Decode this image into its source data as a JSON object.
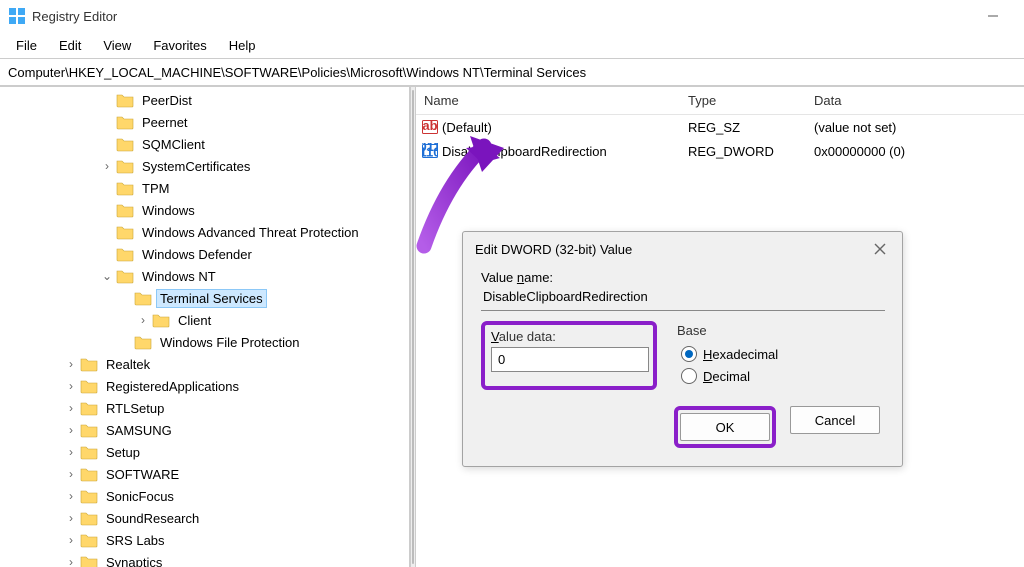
{
  "window": {
    "title": "Registry Editor"
  },
  "menu": {
    "file": "File",
    "edit": "Edit",
    "view": "View",
    "favorites": "Favorites",
    "help": "Help"
  },
  "address": "Computer\\HKEY_LOCAL_MACHINE\\SOFTWARE\\Policies\\Microsoft\\Windows NT\\Terminal Services",
  "columns": {
    "name": "Name",
    "type": "Type",
    "data": "Data"
  },
  "values": [
    {
      "name": "(Default)",
      "type": "REG_SZ",
      "data": "(value not set)",
      "icon": "string"
    },
    {
      "name": "DisableClipboardRedirection",
      "type": "REG_DWORD",
      "data": "0x00000000 (0)",
      "icon": "binary"
    }
  ],
  "tree": [
    {
      "d": 5,
      "t": "",
      "n": "PeerDist"
    },
    {
      "d": 5,
      "t": "",
      "n": "Peernet"
    },
    {
      "d": 5,
      "t": "",
      "n": "SQMClient"
    },
    {
      "d": 5,
      "t": ">",
      "n": "SystemCertificates"
    },
    {
      "d": 5,
      "t": "",
      "n": "TPM"
    },
    {
      "d": 5,
      "t": "",
      "n": "Windows"
    },
    {
      "d": 5,
      "t": "",
      "n": "Windows Advanced Threat Protection"
    },
    {
      "d": 5,
      "t": "",
      "n": "Windows Defender"
    },
    {
      "d": 5,
      "t": "v",
      "n": "Windows NT"
    },
    {
      "d": 6,
      "t": "",
      "n": "Terminal Services",
      "sel": true
    },
    {
      "d": 7,
      "t": ">",
      "n": "Client"
    },
    {
      "d": 6,
      "t": "",
      "n": "Windows File Protection"
    },
    {
      "d": 3,
      "t": ">",
      "n": "Realtek"
    },
    {
      "d": 3,
      "t": ">",
      "n": "RegisteredApplications"
    },
    {
      "d": 3,
      "t": ">",
      "n": "RTLSetup"
    },
    {
      "d": 3,
      "t": ">",
      "n": "SAMSUNG"
    },
    {
      "d": 3,
      "t": ">",
      "n": "Setup"
    },
    {
      "d": 3,
      "t": ">",
      "n": "SOFTWARE"
    },
    {
      "d": 3,
      "t": ">",
      "n": "SonicFocus"
    },
    {
      "d": 3,
      "t": ">",
      "n": "SoundResearch"
    },
    {
      "d": 3,
      "t": ">",
      "n": "SRS Labs"
    },
    {
      "d": 3,
      "t": ">",
      "n": "Synaptics"
    }
  ],
  "dialog": {
    "title": "Edit DWORD (32-bit) Value",
    "valueNameLabel": "Value name:",
    "valueName": "DisableClipboardRedirection",
    "valueDataLabel": "Value data:",
    "valueData": "0",
    "baseLabel": "Base",
    "hex": "Hexadecimal",
    "dec": "Decimal",
    "ok": "OK",
    "cancel": "Cancel"
  }
}
